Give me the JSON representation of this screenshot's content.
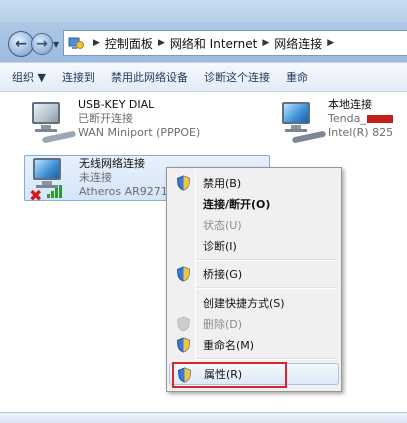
{
  "address": {
    "crumbs": [
      "控制面板",
      "网络和 Internet",
      "网络连接"
    ]
  },
  "toolbar": {
    "items": [
      "组织 ▼",
      "连接到",
      "禁用此网络设备",
      "诊断这个连接",
      "重命"
    ]
  },
  "connections": [
    {
      "name": "USB-KEY DIAL",
      "status": "已断开连接",
      "device": "WAN Miniport (PPPOE)"
    },
    {
      "name": "本地连接",
      "status": "Tenda_",
      "device": "Intel(R) 825"
    },
    {
      "name": "无线网络连接",
      "status": "未连接",
      "device": "Atheros AR9271"
    }
  ],
  "context_menu": {
    "items": [
      {
        "label": "禁用(B)",
        "shield": true,
        "bold": false,
        "disabled": false
      },
      {
        "label": "连接/断开(O)",
        "shield": false,
        "bold": true,
        "disabled": false
      },
      {
        "label": "状态(U)",
        "shield": false,
        "bold": false,
        "disabled": true
      },
      {
        "label": "诊断(I)",
        "shield": false,
        "bold": false,
        "disabled": false
      },
      {
        "label": "桥接(G)",
        "shield": true,
        "bold": false,
        "disabled": false
      },
      {
        "label": "创建快捷方式(S)",
        "shield": false,
        "bold": false,
        "disabled": false
      },
      {
        "label": "删除(D)",
        "shield": true,
        "bold": false,
        "disabled": true
      },
      {
        "label": "重命名(M)",
        "shield": true,
        "bold": false,
        "disabled": false
      },
      {
        "label": "属性(R)",
        "shield": true,
        "bold": false,
        "disabled": false,
        "highlighted": true
      }
    ]
  },
  "colors": {
    "highlight_box": "#d9262c",
    "selection": "#d4e5f8"
  }
}
